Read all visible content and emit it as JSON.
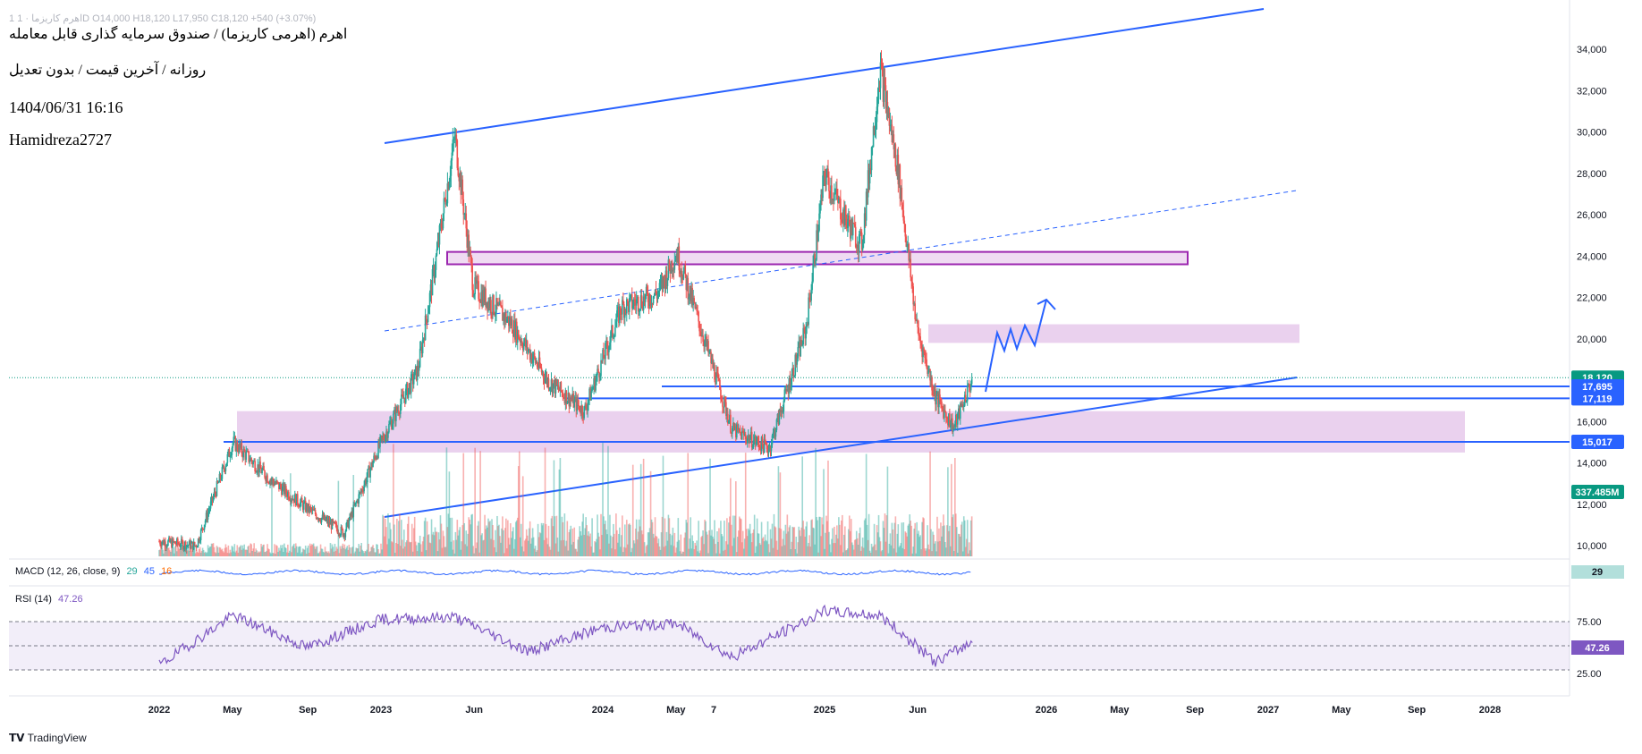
{
  "header": {
    "symbol_strip": "1  اهرم کاریزما · 1D  O14,000  H18,120  L17,950  C18,120  +540 (+3.07%)",
    "title": "اهرم (اهرمی کاریزما) / صندوق سرمایه گذاری قابل معامله",
    "subtitle": "روزانه / آخرین قیمت / بدون تعدیل",
    "datetime": "1404/06/31 16:16",
    "author": "Hamidreza2727"
  },
  "macd_pane": {
    "label": "MACD (12, 26, close, 9)",
    "values": [
      "29",
      "45",
      "16"
    ],
    "badge": "29"
  },
  "rsi_pane": {
    "label": "RSI (14)",
    "value": "47.26",
    "badge": "47.26",
    "levels": [
      "75.00",
      "25.00"
    ]
  },
  "price_badges": {
    "last": "18,120",
    "l1": "17,695",
    "l2": "17,119",
    "l3": "15,017",
    "volume": "337.485M"
  },
  "footer": {
    "brand": "TradingView"
  },
  "colors": {
    "up": "#26a69a",
    "down": "#ef5350",
    "trend": "#2962ff",
    "zone": "#e1bee7",
    "zone_border": "#9c27b0",
    "rsi": "#7e57c2",
    "last_badge": "#089981"
  },
  "chart_data": {
    "type": "candlestick",
    "y_ticks": [
      "34,000",
      "32,000",
      "30,000",
      "28,000",
      "26,000",
      "24,000",
      "22,000",
      "20,000",
      "18,000",
      "16,000",
      "14,000",
      "12,000",
      "10,000"
    ],
    "x_ticks": [
      "2022",
      "May",
      "Sep",
      "2023",
      "Jun",
      "2024",
      "May",
      "7",
      "2025",
      "Jun",
      "2026",
      "May",
      "Sep",
      "2027",
      "May",
      "Sep",
      "2028"
    ],
    "ylim": [
      10000,
      34000
    ],
    "last_price": 18120,
    "horizontal_levels": [
      17695,
      17119,
      15017
    ],
    "zones": [
      {
        "name": "upper",
        "from": 23600,
        "to": 24200
      },
      {
        "name": "target",
        "from": 19800,
        "to": 20700
      },
      {
        "name": "support",
        "from": 14500,
        "to": 16500
      }
    ],
    "price_path": [
      {
        "x": "2022-01",
        "y": 10200
      },
      {
        "x": "2022-03",
        "y": 10000
      },
      {
        "x": "2022-05",
        "y": 15000
      },
      {
        "x": "2022-07",
        "y": 13200
      },
      {
        "x": "2022-09",
        "y": 11800
      },
      {
        "x": "2022-11",
        "y": 10600
      },
      {
        "x": "2023-01",
        "y": 15000
      },
      {
        "x": "2023-03",
        "y": 18500
      },
      {
        "x": "2023-04",
        "y": 24000
      },
      {
        "x": "2023-05",
        "y": 29800
      },
      {
        "x": "2023-06",
        "y": 22500
      },
      {
        "x": "2023-08",
        "y": 20800
      },
      {
        "x": "2023-10",
        "y": 18000
      },
      {
        "x": "2023-12",
        "y": 16500
      },
      {
        "x": "2024-02",
        "y": 21500
      },
      {
        "x": "2024-04",
        "y": 22200
      },
      {
        "x": "2024-05",
        "y": 24200
      },
      {
        "x": "2024-07",
        "y": 18500
      },
      {
        "x": "2024-08",
        "y": 15600
      },
      {
        "x": "2024-10",
        "y": 14700
      },
      {
        "x": "2024-12",
        "y": 20500
      },
      {
        "x": "2025-01",
        "y": 28000
      },
      {
        "x": "2025-02",
        "y": 26000
      },
      {
        "x": "2025-03",
        "y": 24500
      },
      {
        "x": "2025-04",
        "y": 33100
      },
      {
        "x": "2025-05",
        "y": 28000
      },
      {
        "x": "2025-06",
        "y": 20500
      },
      {
        "x": "2025-07",
        "y": 17200
      },
      {
        "x": "2025-08",
        "y": 15700
      },
      {
        "x": "2025-09",
        "y": 18120
      }
    ],
    "rsi": [
      {
        "x": "2022-01",
        "y": 18
      },
      {
        "x": "2022-05",
        "y": 80
      },
      {
        "x": "2022-09",
        "y": 40
      },
      {
        "x": "2023-01",
        "y": 75
      },
      {
        "x": "2023-05",
        "y": 78
      },
      {
        "x": "2023-09",
        "y": 35
      },
      {
        "x": "2024-01",
        "y": 65
      },
      {
        "x": "2024-05",
        "y": 70
      },
      {
        "x": "2024-08",
        "y": 28
      },
      {
        "x": "2025-01",
        "y": 85
      },
      {
        "x": "2025-04",
        "y": 80
      },
      {
        "x": "2025-07",
        "y": 22
      },
      {
        "x": "2025-09",
        "y": 47.26
      }
    ]
  }
}
